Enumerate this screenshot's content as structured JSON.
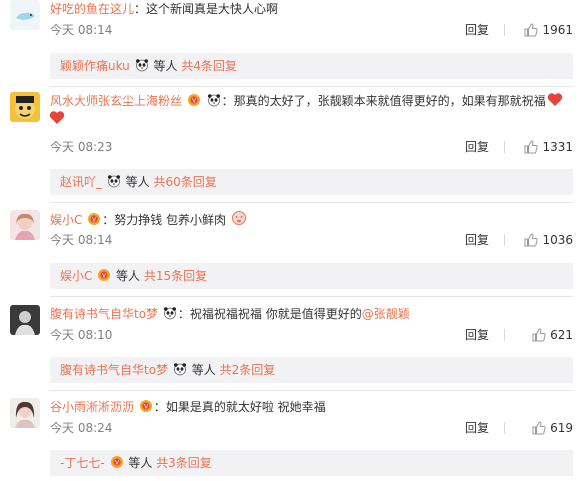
{
  "comments": [
    {
      "username": "好吃的鱼在这儿",
      "text": "：这个新闻真是大快人心啊",
      "time": "今天 08:14",
      "reply_label": "回复",
      "likes": "1961",
      "sub": {
        "user": "颖颖作痛uku",
        "tail": "等人",
        "count": "共4条回复"
      }
    },
    {
      "username": "风水大师张玄尘上海粉丝",
      "text": "：那真的太好了，张靓颖本来就值得更好的，如果有那就祝福",
      "time": "今天 08:23",
      "reply_label": "回复",
      "likes": "1331",
      "sub": {
        "user": "赵讯吖_",
        "tail": "等人",
        "count": "共60条回复"
      }
    },
    {
      "username": "娱小C",
      "text": "：努力挣钱 包养小鲜肉",
      "time": "今天 08:14",
      "reply_label": "回复",
      "likes": "1036",
      "sub": {
        "user": "娱小C",
        "tail": "等人",
        "count": "共15条回复"
      }
    },
    {
      "username": "腹有诗书气自华to梦",
      "text": "：祝福祝福祝福  你就是值得更好的",
      "mention": "@张靓颖",
      "time": "今天 08:10",
      "reply_label": "回复",
      "likes": "621",
      "sub": {
        "user": "腹有诗书气自华to梦",
        "tail": "等人",
        "count": "共2条回复"
      }
    },
    {
      "username": "谷小雨淅淅沥沥",
      "text": "：如果是真的就太好啦 祝她幸福",
      "time": "今天 08:24",
      "reply_label": "回复",
      "likes": "619",
      "sub": {
        "user": "-丁七七-",
        "tail": "等人",
        "count": "共3条回复"
      }
    }
  ],
  "colors": {
    "username": "#eb7350",
    "meta": "#808080",
    "subbox_bg": "#f2f2f5",
    "heart": "#e8443a"
  },
  "icons": [
    "panda-emoji-icon",
    "vip-badge-icon",
    "heart-emoji-icon",
    "thumb-up-icon"
  ]
}
